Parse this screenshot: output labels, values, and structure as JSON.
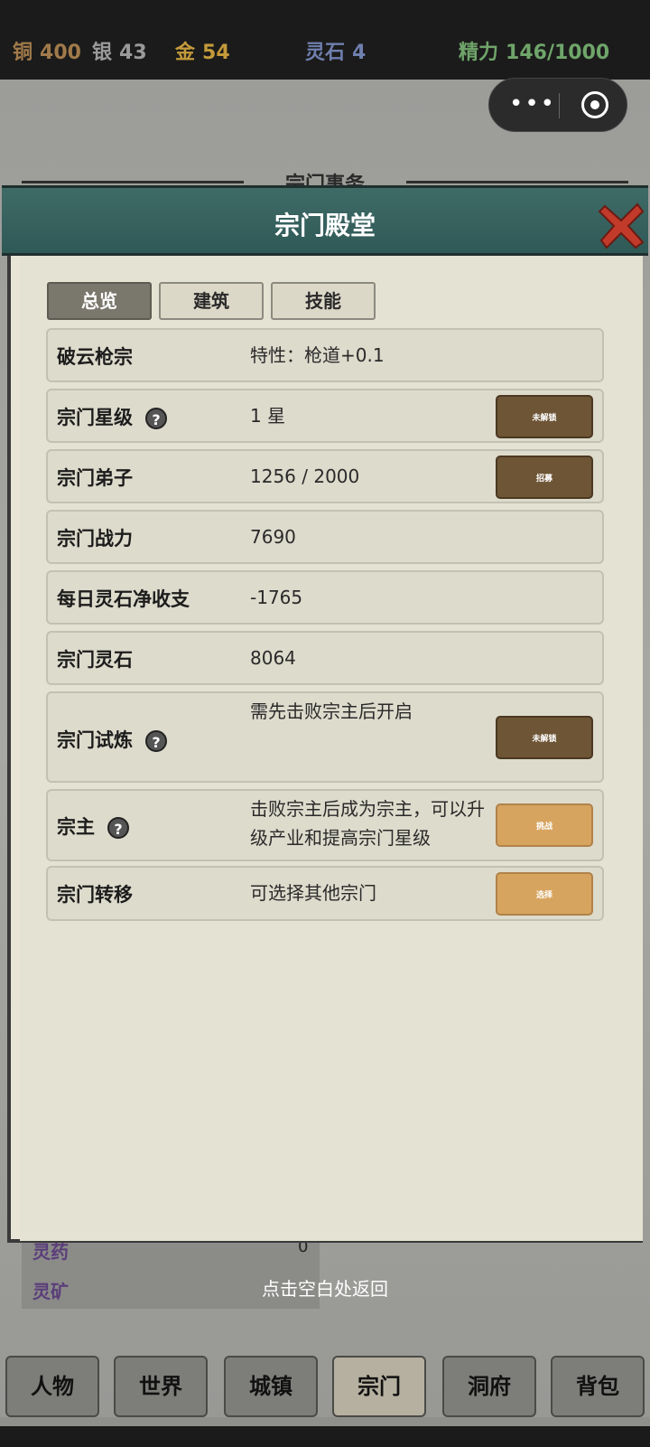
{
  "topbar": {
    "resources": [
      {
        "label": "铜",
        "value": "400",
        "color": "#a07a4a"
      },
      {
        "label": "银",
        "value": "43",
        "color": "#9a9a9a"
      },
      {
        "label": "金",
        "value": "54",
        "color": "#c49a3a"
      },
      {
        "label": "灵石",
        "value": "4",
        "color": "#6f7fae"
      },
      {
        "label": "精力",
        "value": "146/1000",
        "color": "#6fa56a"
      }
    ]
  },
  "background": {
    "section_title": "宗门事务",
    "rows": [
      {
        "label": "灵药",
        "value": "0"
      },
      {
        "label": "灵矿",
        "value": ""
      }
    ],
    "return_hint": "点击空白处返回"
  },
  "panel": {
    "title": "宗门殿堂",
    "tabs": [
      "总览",
      "建筑",
      "技能"
    ],
    "rows": {
      "sect_name": {
        "label": "破云枪宗",
        "value": "特性：枪道+0.1"
      },
      "star": {
        "label": "宗门星级",
        "value": "1 星",
        "button": "未解锁"
      },
      "disciples": {
        "label": "宗门弟子",
        "value": "1256 / 2000",
        "button": "招募"
      },
      "power": {
        "label": "宗门战力",
        "value": "7690"
      },
      "daily_income": {
        "label": "每日灵石净收支",
        "value": "-1765"
      },
      "spirit_stone": {
        "label": "宗门灵石",
        "value": "8064"
      },
      "trial": {
        "label": "宗门试炼",
        "value": "需先击败宗主后开启",
        "button": "未解锁"
      },
      "leader": {
        "label": "宗主",
        "value": "击败宗主后成为宗主，可以升级产业和提高宗门星级",
        "button": "挑战"
      },
      "transfer": {
        "label": "宗门转移",
        "value": "可选择其他宗门",
        "button": "选择"
      }
    }
  },
  "bottom_nav": [
    "人物",
    "世界",
    "城镇",
    "宗门",
    "洞府",
    "背包"
  ],
  "colors": {
    "panel_header": "#2f5956",
    "button_dark": "#6e5535",
    "button_light": "#d7a45f"
  }
}
